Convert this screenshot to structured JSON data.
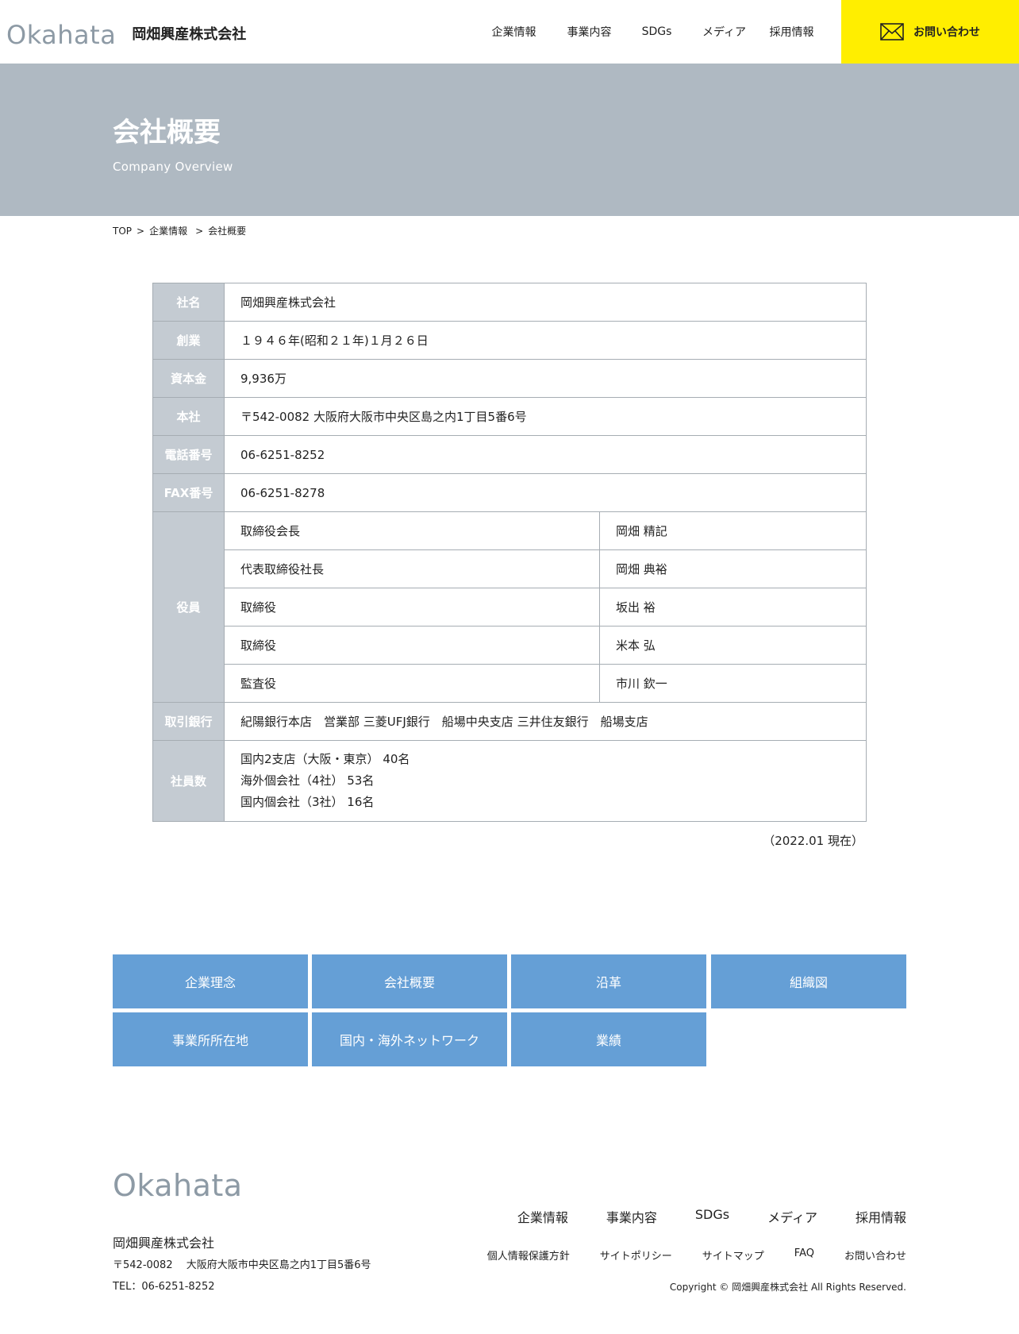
{
  "header": {
    "logo_mark": "Okahata",
    "company_name": "岡畑興産株式会社",
    "nav": [
      "企業情報",
      "事業内容",
      "SDGs",
      "メディア",
      "採用情報"
    ],
    "contact_label": "お問い合わせ",
    "contact_icon": "mail-icon",
    "contact_bg": "#ffee00"
  },
  "hero": {
    "title": "会社概要",
    "subtitle": "Company Overview",
    "bg_color": "#afb9c2"
  },
  "breadcrumb": {
    "items": [
      "TOP",
      "企業情報",
      "会社概要"
    ],
    "separator": ">"
  },
  "overview": {
    "rows": [
      {
        "label": "社名",
        "value": "岡畑興産株式会社"
      },
      {
        "label": "創業",
        "value": "１９４６年(昭和２１年)１月２６日"
      },
      {
        "label": "資本金",
        "value": "9,936万"
      },
      {
        "label": "本社",
        "value": "〒542-0082 大阪府大阪市中央区島之内1丁目5番6号"
      },
      {
        "label": "電話番号",
        "value": "06-6251-8252"
      },
      {
        "label": "FAX番号",
        "value": "06-6251-8278"
      }
    ],
    "officers_label": "役員",
    "officers": [
      {
        "title": "取締役会長",
        "name": "岡畑 精記"
      },
      {
        "title": "代表取締役社長",
        "name": "岡畑 典裕"
      },
      {
        "title": "取締役",
        "name": "坂出 裕"
      },
      {
        "title": "取締役",
        "name": "米本 弘"
      },
      {
        "title": "監査役",
        "name": "市川 欽一"
      }
    ],
    "bank_label": "取引銀行",
    "bank_value": "紀陽銀行本店　営業部 三菱UFJ銀行　船場中央支店 三井住友銀行　船場支店",
    "employees_label": "社員数",
    "employees": [
      "国内2支店（大阪・東京） 40名",
      "海外個会社（4社） 53名",
      "国内個会社（3社） 16名"
    ],
    "note": "（2022.01 現在）"
  },
  "subnav": {
    "buttons": [
      "企業理念",
      "会社概要",
      "沿革",
      "組織図",
      "事業所所在地",
      "国内・海外ネットワーク",
      "業績"
    ],
    "color": "#659fd6"
  },
  "footer": {
    "logo_mark": "Okahata",
    "company": "岡畑興産株式会社",
    "address": "〒542-0082　 大阪府大阪市中央区島之内1丁目5番6号",
    "tel": "TEL：06-6251-8252",
    "nav": [
      "企業情報",
      "事業内容",
      "SDGs",
      "メディア",
      "採用情報"
    ],
    "sub_links": [
      "個人情報保護方針",
      "サイトポリシー",
      "サイトマップ",
      "FAQ",
      "お問い合わせ"
    ],
    "copyright": "Copyright © 岡畑興産株式会社 All Rights Reserved."
  }
}
